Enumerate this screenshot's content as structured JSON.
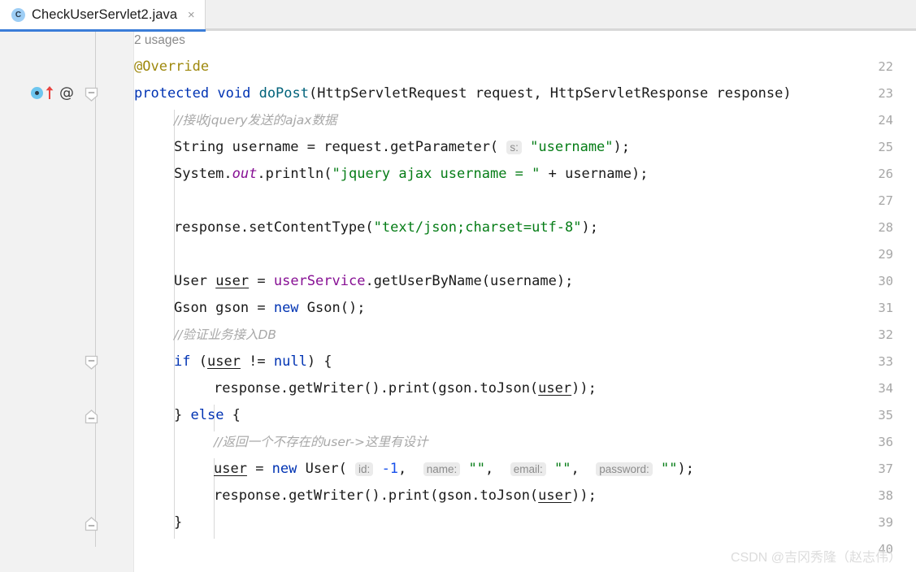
{
  "window": {
    "accent_color": "#3b7dd8",
    "editor_bg": "#ffffff",
    "gutter_bg": "#f2f2f2"
  },
  "tab": {
    "icon_name": "java-class-icon",
    "icon_letter": "C",
    "title": "CheckUserServlet2.java",
    "close_label": "×"
  },
  "code_vision": {
    "usages_hint": "2 usages"
  },
  "gutter": {
    "line_numbers": [
      "22",
      "23",
      "24",
      "25",
      "26",
      "27",
      "28",
      "29",
      "30",
      "31",
      "32",
      "33",
      "34",
      "35",
      "36",
      "37",
      "38",
      "39",
      "40"
    ],
    "markers": {
      "implementing_method_line": "23",
      "annotation_line": "23",
      "fold_collapse_lines": [
        "23",
        "33"
      ],
      "fold_end_lines": [
        "35",
        "39"
      ]
    }
  },
  "code": {
    "lines": [
      {
        "n": "22",
        "text": "@Override"
      },
      {
        "n": "23",
        "text": "protected void doPost(HttpServletRequest request, HttpServletResponse response)"
      },
      {
        "n": "24",
        "text": "//接收jquery发送的ajax数据"
      },
      {
        "n": "25",
        "text": "String username = request.getParameter( s: \"username\");"
      },
      {
        "n": "26",
        "text": "System.out.println(\"jquery ajax username = \" + username);"
      },
      {
        "n": "27",
        "text": ""
      },
      {
        "n": "28",
        "text": "response.setContentType(\"text/json;charset=utf-8\");"
      },
      {
        "n": "29",
        "text": ""
      },
      {
        "n": "30",
        "text": "User user = userService.getUserByName(username);"
      },
      {
        "n": "31",
        "text": "Gson gson = new Gson();"
      },
      {
        "n": "32",
        "text": "//验证业务接入DB"
      },
      {
        "n": "33",
        "text": "if (user != null) {"
      },
      {
        "n": "34",
        "text": "response.getWriter().print(gson.toJson(user));"
      },
      {
        "n": "35",
        "text": "} else {"
      },
      {
        "n": "36",
        "text": "//返回一个不存在的user->这里有设计"
      },
      {
        "n": "37",
        "text": "user = new User( id: -1,  name: \"\",  email: \"\",  password: \"\");"
      },
      {
        "n": "38",
        "text": "response.getWriter().print(gson.toJson(user));"
      },
      {
        "n": "39",
        "text": "}"
      },
      {
        "n": "40",
        "text": ""
      }
    ],
    "parameter_hints": [
      "s:",
      "id:",
      "name:",
      "email:",
      "password:"
    ],
    "token_colors": {
      "keyword": "#0033b3",
      "string": "#067d17",
      "number": "#1750eb",
      "comment": "#a8a8a8",
      "annotation": "#9e880d",
      "static_field": "#871094",
      "default": "#1a1a1a"
    }
  },
  "watermark": {
    "text": "CSDN @吉冈秀隆（赵志伟）"
  }
}
